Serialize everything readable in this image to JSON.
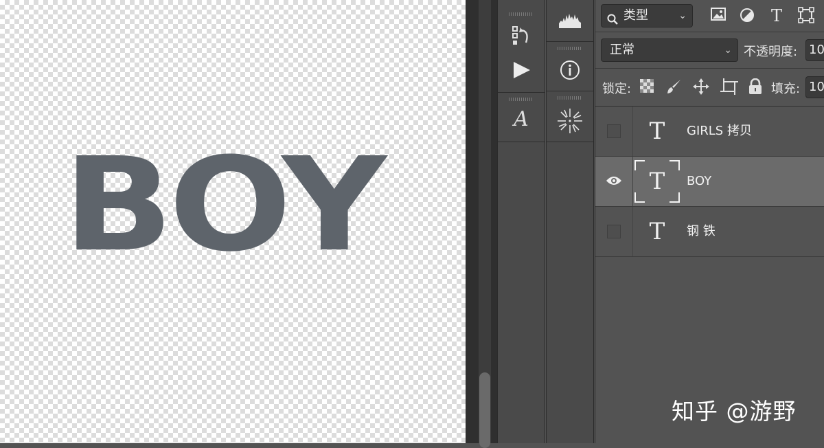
{
  "canvas": {
    "text": "BOY",
    "text_color": "#5e646b"
  },
  "tools_left": [
    {
      "icon": "history-icon"
    },
    {
      "icon": "play-actions-icon"
    },
    {
      "icon": "character-icon",
      "glyph": "A"
    }
  ],
  "tools_right": [
    {
      "icon": "histogram-icon"
    },
    {
      "icon": "info-icon",
      "glyph": "i"
    },
    {
      "icon": "brush-settings-icon"
    }
  ],
  "layers_panel": {
    "filter": {
      "label": "类型",
      "icon": "search-icon"
    },
    "filter_tools": [
      "image-filter-icon",
      "adjustment-filter-icon",
      "type-filter-icon",
      "shape-filter-icon"
    ],
    "blend_mode": "正常",
    "opacity_label": "不透明度:",
    "opacity_value": "10",
    "lock_label": "锁定:",
    "lock_icons": [
      "lock-transparent-icon",
      "lock-paint-icon",
      "lock-position-icon",
      "lock-artboard-icon",
      "lock-all-icon"
    ],
    "fill_label": "填充:",
    "fill_value": "10",
    "layers": [
      {
        "name": "GIRLS 拷贝",
        "visible": false,
        "selected": false
      },
      {
        "name": "BOY",
        "visible": true,
        "selected": true
      },
      {
        "name": "钢 铁",
        "visible": false,
        "selected": false
      }
    ]
  },
  "watermark": "知乎 @游野",
  "colors": {
    "panel_bg": "#535353",
    "selected_row": "#6b6b6b",
    "strip_bg": "#4a4a4a"
  }
}
